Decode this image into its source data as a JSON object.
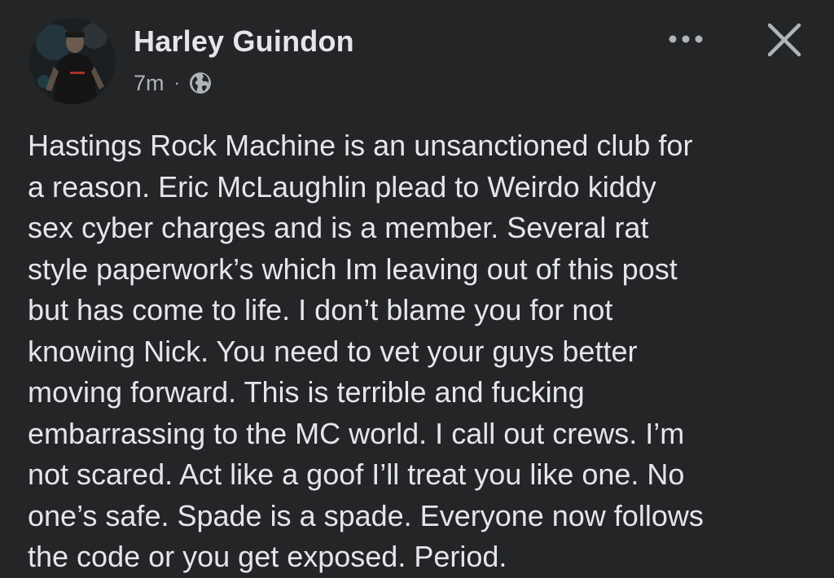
{
  "post": {
    "author": "Harley Guindon",
    "timestamp": "7m",
    "separator": "·",
    "audience_icon": "globe-icon",
    "more_icon": "more-options-icon",
    "close_icon": "close-icon",
    "lines": [
      "Hastings Rock Machine is an unsanctioned club for",
      "a reason. Eric McLaughlin plead to Weirdo kiddy",
      "sex cyber charges and is a member. Several rat",
      "style paperwork’s which Im leaving out of this post",
      "but has come to life. I don’t blame you for not",
      "knowing Nick. You need to vet your guys better",
      "moving forward. This is terrible and fucking",
      "embarrassing to the MC world. I call out crews. I’m",
      "not scared. Act like a goof I’ll treat you like one. No",
      "one’s safe. Spade is a spade. Everyone now follows",
      "the code or you get exposed. Period."
    ]
  },
  "colors": {
    "background": "#242526",
    "primary_text": "#e4e6eb",
    "secondary_text": "#b0b3b8"
  }
}
